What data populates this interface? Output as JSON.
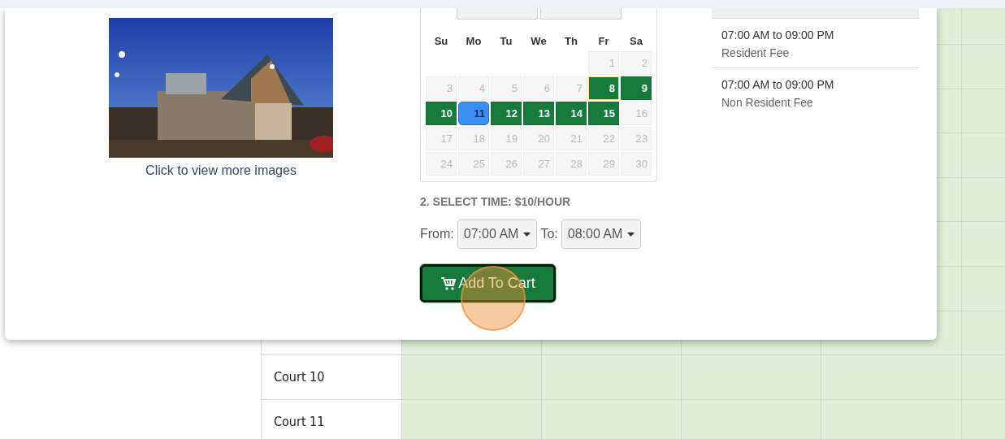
{
  "image_caption": "Click to view more images",
  "calendar": {
    "weekdays": [
      "Su",
      "Mo",
      "Tu",
      "We",
      "Th",
      "Fr",
      "Sa"
    ],
    "weeks": [
      [
        {
          "kind": "blank"
        },
        {
          "kind": "blank"
        },
        {
          "kind": "blank"
        },
        {
          "kind": "blank"
        },
        {
          "kind": "blank"
        },
        {
          "kind": "day",
          "day": "1",
          "available": false,
          "selected": false,
          "today": false
        },
        {
          "kind": "day",
          "day": "2",
          "available": false,
          "selected": false,
          "today": false
        }
      ],
      [
        {
          "kind": "day",
          "day": "3",
          "available": false,
          "selected": false,
          "today": false
        },
        {
          "kind": "day",
          "day": "4",
          "available": false,
          "selected": false,
          "today": false
        },
        {
          "kind": "day",
          "day": "5",
          "available": false,
          "selected": false,
          "today": false
        },
        {
          "kind": "day",
          "day": "6",
          "available": false,
          "selected": false,
          "today": false
        },
        {
          "kind": "day",
          "day": "7",
          "available": false,
          "selected": false,
          "today": false
        },
        {
          "kind": "day",
          "day": "8",
          "available": true,
          "selected": false,
          "today": true
        },
        {
          "kind": "day",
          "day": "9",
          "available": true,
          "selected": false,
          "today": false
        }
      ],
      [
        {
          "kind": "day",
          "day": "10",
          "available": true,
          "selected": false,
          "today": false
        },
        {
          "kind": "day",
          "day": "11",
          "available": true,
          "selected": true,
          "today": false
        },
        {
          "kind": "day",
          "day": "12",
          "available": true,
          "selected": false,
          "today": false
        },
        {
          "kind": "day",
          "day": "13",
          "available": true,
          "selected": false,
          "today": false
        },
        {
          "kind": "day",
          "day": "14",
          "available": true,
          "selected": false,
          "today": false
        },
        {
          "kind": "day",
          "day": "15",
          "available": true,
          "selected": false,
          "today": false
        },
        {
          "kind": "day",
          "day": "16",
          "available": false,
          "selected": false,
          "today": false
        }
      ],
      [
        {
          "kind": "day",
          "day": "17",
          "available": false,
          "selected": false,
          "today": false
        },
        {
          "kind": "day",
          "day": "18",
          "available": false,
          "selected": false,
          "today": false
        },
        {
          "kind": "day",
          "day": "19",
          "available": false,
          "selected": false,
          "today": false
        },
        {
          "kind": "day",
          "day": "20",
          "available": false,
          "selected": false,
          "today": false
        },
        {
          "kind": "day",
          "day": "21",
          "available": false,
          "selected": false,
          "today": false
        },
        {
          "kind": "day",
          "day": "22",
          "available": false,
          "selected": false,
          "today": false
        },
        {
          "kind": "day",
          "day": "23",
          "available": false,
          "selected": false,
          "today": false
        }
      ],
      [
        {
          "kind": "day",
          "day": "24",
          "available": false,
          "selected": false,
          "today": false
        },
        {
          "kind": "day",
          "day": "25",
          "available": false,
          "selected": false,
          "today": false
        },
        {
          "kind": "day",
          "day": "26",
          "available": false,
          "selected": false,
          "today": false
        },
        {
          "kind": "day",
          "day": "27",
          "available": false,
          "selected": false,
          "today": false
        },
        {
          "kind": "day",
          "day": "28",
          "available": false,
          "selected": false,
          "today": false
        },
        {
          "kind": "day",
          "day": "29",
          "available": false,
          "selected": false,
          "today": false
        },
        {
          "kind": "day",
          "day": "30",
          "available": false,
          "selected": false,
          "today": false
        }
      ]
    ]
  },
  "time": {
    "heading": "2. SELECT TIME: $10/HOUR",
    "from_label": "From:",
    "from_value": "07:00 AM",
    "to_label": "To:",
    "to_value": "08:00 AM"
  },
  "add_button": "Add To Cart",
  "fees": [
    {
      "time": "07:00 AM to 09:00 PM",
      "name": "Resident Fee"
    },
    {
      "time": "07:00 AM to 09:00 PM",
      "name": "Non Resident Fee"
    }
  ],
  "courts": [
    "Court 10",
    "Court 11"
  ]
}
